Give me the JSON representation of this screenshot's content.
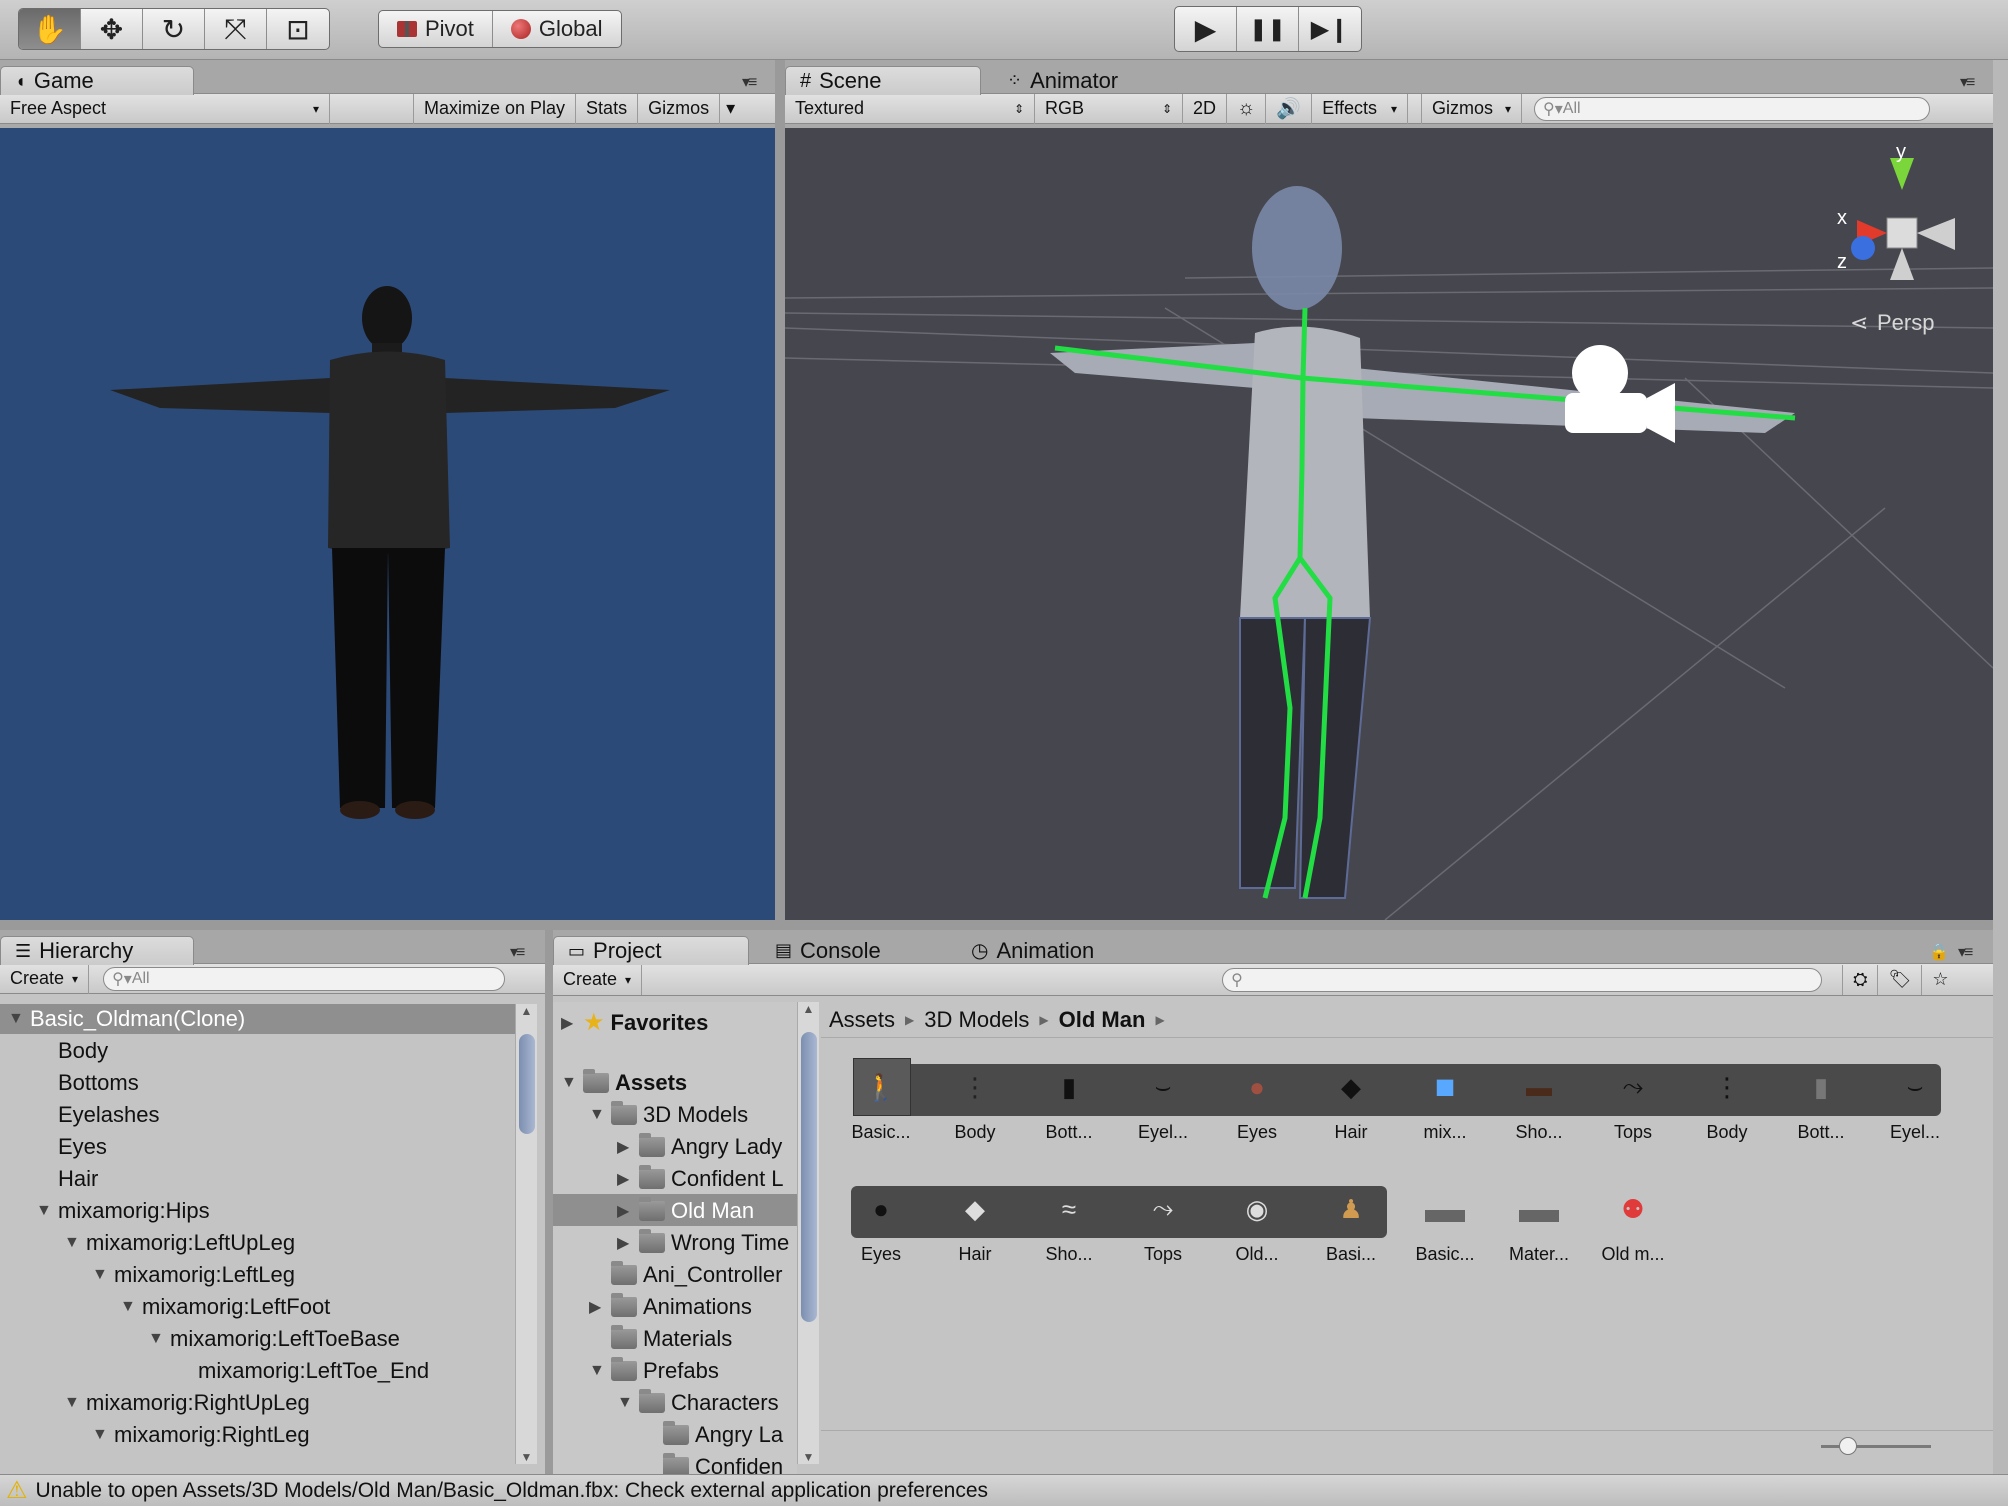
{
  "toolbar": {
    "transform_tools": [
      {
        "name": "hand-tool",
        "glyph": "✋"
      },
      {
        "name": "move-tool",
        "glyph": "✥"
      },
      {
        "name": "rotate-tool",
        "glyph": "↻"
      },
      {
        "name": "scale-tool",
        "glyph": "⤧"
      },
      {
        "name": "rect-tool",
        "glyph": "⊡"
      }
    ],
    "pivot_label": "Pivot",
    "global_label": "Global",
    "play_glyph": "▶",
    "pause_glyph": "❚❚",
    "step_glyph": "▶❙"
  },
  "game": {
    "tab_label": "Game",
    "aspect_label": "Free Aspect",
    "maximize_label": "Maximize on Play",
    "stats_label": "Stats",
    "gizmos_label": "Gizmos",
    "background": "#2c4a78"
  },
  "scene": {
    "tab_label": "Scene",
    "animator_tab_label": "Animator",
    "draw_mode_label": "Textured",
    "render_mode_label": "RGB",
    "mode_2d_label": "2D",
    "effects_label": "Effects",
    "gizmos_label": "Gizmos",
    "search_placeholder": "All",
    "persp_label": "Persp",
    "axis_x": "x",
    "axis_y": "y",
    "axis_z": "z",
    "bone_color": "#22dd44",
    "background": "#46464e"
  },
  "hierarchy": {
    "tab_label": "Hierarchy",
    "create_label": "Create",
    "search_placeholder": "All",
    "items": [
      {
        "label": "Basic_Oldman(Clone)",
        "depth": 0,
        "expanded": true,
        "selected": true
      },
      {
        "label": "Body",
        "depth": 1
      },
      {
        "label": "Bottoms",
        "depth": 1
      },
      {
        "label": "Eyelashes",
        "depth": 1
      },
      {
        "label": "Eyes",
        "depth": 1
      },
      {
        "label": "Hair",
        "depth": 1
      },
      {
        "label": "mixamorig:Hips",
        "depth": 1,
        "expanded": true
      },
      {
        "label": "mixamorig:LeftUpLeg",
        "depth": 2,
        "expanded": true
      },
      {
        "label": "mixamorig:LeftLeg",
        "depth": 3,
        "expanded": true
      },
      {
        "label": "mixamorig:LeftFoot",
        "depth": 4,
        "expanded": true
      },
      {
        "label": "mixamorig:LeftToeBase",
        "depth": 5,
        "expanded": true
      },
      {
        "label": "mixamorig:LeftToe_End",
        "depth": 6
      },
      {
        "label": "mixamorig:RightUpLeg",
        "depth": 2,
        "expanded": true
      },
      {
        "label": "mixamorig:RightLeg",
        "depth": 3,
        "expanded": true
      }
    ]
  },
  "project": {
    "tab_label": "Project",
    "console_tab_label": "Console",
    "animation_tab_label": "Animation",
    "create_label": "Create",
    "favorites_label": "Favorites",
    "tree": [
      {
        "label": "Assets",
        "depth": 0,
        "expanded": true,
        "bold": true
      },
      {
        "label": "3D Models",
        "depth": 1,
        "expanded": true
      },
      {
        "label": "Angry Lady",
        "depth": 2,
        "collapsed": true
      },
      {
        "label": "Confident L",
        "depth": 2,
        "collapsed": true
      },
      {
        "label": "Old Man",
        "depth": 2,
        "collapsed": true,
        "selected": true
      },
      {
        "label": "Wrong Time",
        "depth": 2,
        "collapsed": true
      },
      {
        "label": "Ani_Controller",
        "depth": 1
      },
      {
        "label": "Animations",
        "depth": 1,
        "collapsed": true
      },
      {
        "label": "Materials",
        "depth": 1
      },
      {
        "label": "Prefabs",
        "depth": 1,
        "expanded": true
      },
      {
        "label": "Characters",
        "depth": 2,
        "expanded": true
      },
      {
        "label": "Angry La",
        "depth": 3
      },
      {
        "label": "Confiden",
        "depth": 3
      }
    ],
    "breadcrumb": [
      "Assets",
      "3D Models",
      "Old Man"
    ],
    "row1": [
      "Basic...",
      "Body",
      "Bott...",
      "Eyel...",
      "Eyes",
      "Hair",
      "mix...",
      "Sho...",
      "Tops",
      "Body",
      "Bott...",
      "Eyel..."
    ],
    "row2": [
      "Eyes",
      "Hair",
      "Sho...",
      "Tops",
      "Old...",
      "Basi...",
      "Basic...",
      "Mater...",
      "Old m..."
    ]
  },
  "status": {
    "message": "Unable to open Assets/3D Models/Old Man/Basic_Oldman.fbx: Check external application preferences"
  }
}
